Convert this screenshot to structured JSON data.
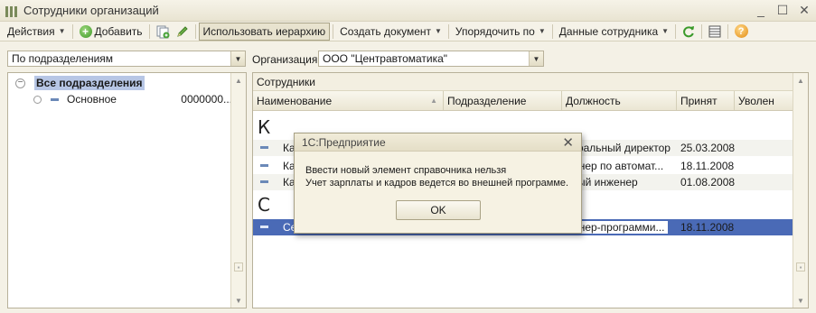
{
  "window": {
    "title": "Сотрудники организаций",
    "minimize": "_",
    "maximize": "☐",
    "close": "✕"
  },
  "toolbar": {
    "actions": "Действия",
    "add": "Добавить",
    "use_hierarchy": "Использовать иерархию",
    "create_document": "Создать документ",
    "sort_by": "Упорядочить по",
    "employee_data": "Данные сотрудника",
    "help": "?"
  },
  "filter": {
    "mode_value": "По подразделениям",
    "org_label": "Организация:",
    "org_value": "ООО \"Центравтоматика\""
  },
  "tree": {
    "root_label": "Все подразделения",
    "items": [
      {
        "label": "Основное",
        "code": "0000000..."
      }
    ]
  },
  "employees": {
    "header": "Сотрудники",
    "columns": [
      "Наименование",
      "Подразделение",
      "Должность",
      "Принят",
      "Уволен"
    ],
    "groups": [
      {
        "letter": "К",
        "rows": [
          {
            "name": "Ка",
            "position": "ьеральный директор",
            "hired": "25.03.2008"
          },
          {
            "name": "Ка",
            "position": "женер по автомат...",
            "hired": "18.11.2008"
          },
          {
            "name": "Ка",
            "position": "вный инженер",
            "hired": "01.08.2008"
          }
        ]
      },
      {
        "letter": "С",
        "rows": [
          {
            "name": "Се",
            "position": "женер-программи...",
            "hired": "18.11.2008"
          }
        ]
      }
    ]
  },
  "dialog": {
    "title": "1С:Предприятие",
    "line1": "Ввести новый элемент справочника нельзя",
    "line2": "Учет зарплаты и кадров ведется во внешней программе.",
    "ok": "OK"
  }
}
